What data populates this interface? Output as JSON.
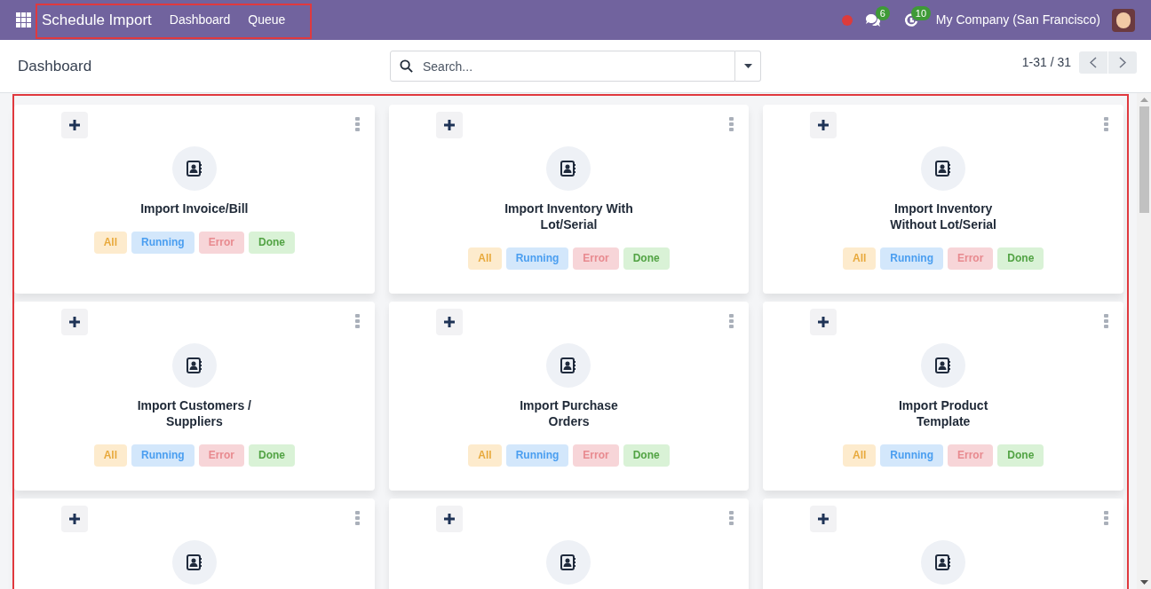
{
  "navbar": {
    "app_title": "Schedule Import",
    "menu": [
      {
        "label": "Dashboard"
      },
      {
        "label": "Queue"
      }
    ],
    "chat_count": "6",
    "activity_count": "10",
    "company": "My Company (San Francisco)"
  },
  "control_panel": {
    "breadcrumb": "Dashboard",
    "search": {
      "placeholder": "Search..."
    },
    "pager": "1-31 / 31"
  },
  "cards": [
    {
      "add_button": true,
      "title": "Import Invoice/Bill",
      "badges": [
        {
          "kind": "all",
          "label": "All"
        },
        {
          "kind": "running",
          "label": "Running"
        },
        {
          "kind": "error",
          "label": "Error"
        },
        {
          "kind": "done",
          "label": "Done"
        }
      ]
    },
    {
      "add_button": true,
      "title": "Import Inventory With Lot/Serial",
      "badges": [
        {
          "kind": "all",
          "label": "All"
        },
        {
          "kind": "running",
          "label": "Running"
        },
        {
          "kind": "error",
          "label": "Error"
        },
        {
          "kind": "done",
          "label": "Done"
        }
      ]
    },
    {
      "add_button": true,
      "title": "Import Inventory Without Lot/Serial",
      "badges": [
        {
          "kind": "all",
          "label": "All"
        },
        {
          "kind": "running",
          "label": "Running"
        },
        {
          "kind": "error",
          "label": "Error"
        },
        {
          "kind": "done",
          "label": "Done"
        }
      ]
    },
    {
      "add_button": true,
      "title": "Import Customers / Suppliers",
      "badges": [
        {
          "kind": "all",
          "label": "All"
        },
        {
          "kind": "running",
          "label": "Running"
        },
        {
          "kind": "error",
          "label": "Error"
        },
        {
          "kind": "done",
          "label": "Done"
        }
      ]
    },
    {
      "add_button": true,
      "title": "Import Purchase Orders",
      "badges": [
        {
          "kind": "all",
          "label": "All"
        },
        {
          "kind": "running",
          "label": "Running"
        },
        {
          "kind": "error",
          "label": "Error"
        },
        {
          "kind": "done",
          "label": "Done"
        }
      ]
    },
    {
      "add_button": true,
      "title": "Import Product Template",
      "badges": [
        {
          "kind": "all",
          "label": "All"
        },
        {
          "kind": "running",
          "label": "Running"
        },
        {
          "kind": "error",
          "label": "Error"
        },
        {
          "kind": "done",
          "label": "Done"
        }
      ]
    },
    {
      "add_button": true
    },
    {
      "add_button": true
    },
    {
      "add_button": true
    }
  ]
}
